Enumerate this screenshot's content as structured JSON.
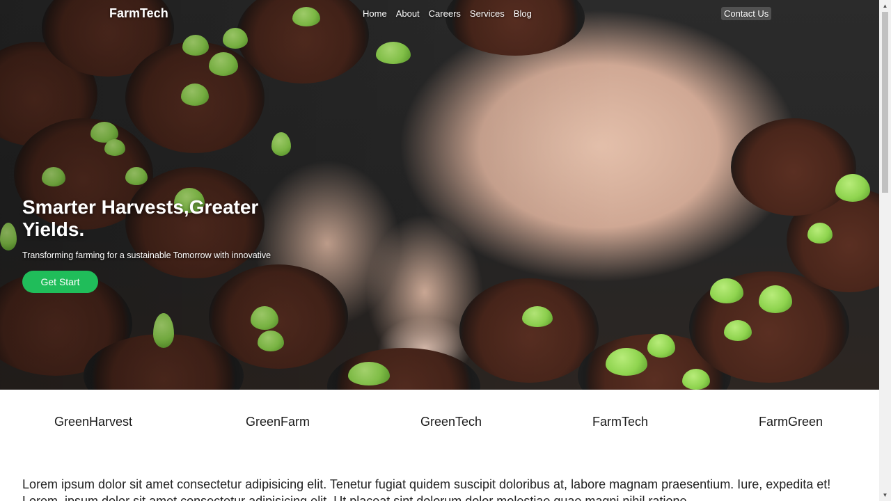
{
  "nav": {
    "brand": "FarmTech",
    "links": [
      "Home",
      "About",
      "Careers",
      "Services",
      "Blog"
    ],
    "contact": "Contact Us"
  },
  "hero": {
    "title": "Smarter Harvests,Greater Yields.",
    "subtitle": "Transforming farming for a sustainable Tomorrow with innovative",
    "cta": "Get Start",
    "image": "seedling-planting-photo"
  },
  "brands": [
    "GreenHarvest",
    "GreenFarm",
    "GreenTech",
    "FarmTech",
    "FarmGreen"
  ],
  "content": {
    "paragraph": "Lorem ipsum dolor sit amet consectetur adipisicing elit. Tenetur fugiat quidem suscipit doloribus at, labore magnam praesentium. Iure, expedita et! Lorem, ipsum dolor sit amet consectetur adipisicing elit. Ut placeat sint dolorum dolor molestiae quae magni nihil ratione."
  },
  "colors": {
    "cta": "#20bd5a",
    "text": "#222222"
  },
  "scrollbar": {
    "up": "up-arrow-icon",
    "down": "down-arrow-icon"
  }
}
